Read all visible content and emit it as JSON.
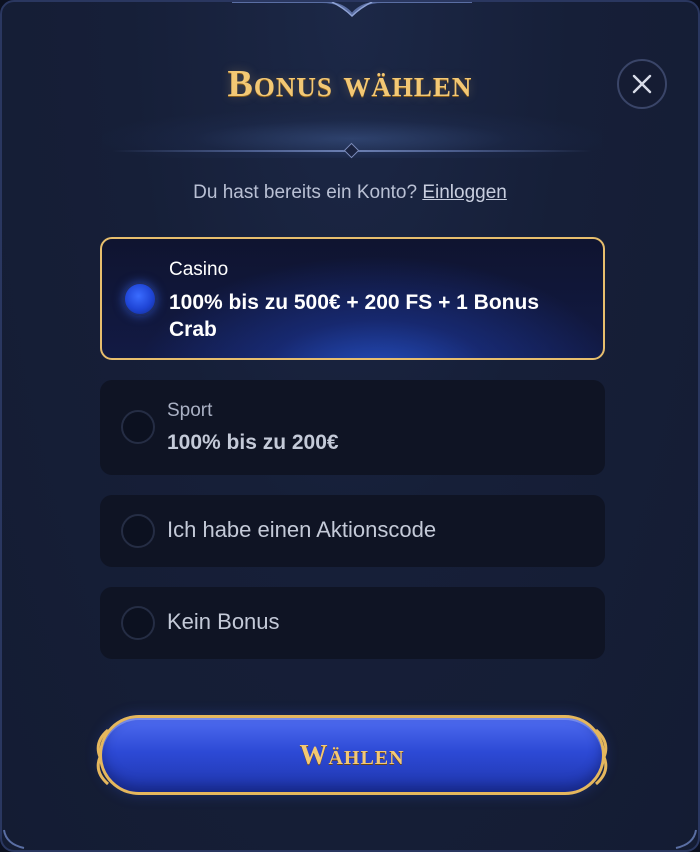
{
  "modal": {
    "title": "Bonus wählen",
    "close_icon": "close-icon",
    "login_prompt": "Du hast bereits ein Konto?",
    "login_link": "Einloggen"
  },
  "options": [
    {
      "category": "Casino",
      "description": "100% bis zu 500€ + 200 FS + 1 Bonus Crab",
      "selected": true
    },
    {
      "category": "Sport",
      "description": "100% bis zu 200€",
      "selected": false
    },
    {
      "label": "Ich habe einen Aktionscode",
      "selected": false
    },
    {
      "label": "Kein Bonus",
      "selected": false
    }
  ],
  "submit": {
    "label": "Wählen"
  },
  "colors": {
    "accent_gold": "#f3c874",
    "selected_border": "#e7be6d",
    "primary_blue": "#2d4ad6",
    "background": "#161f38"
  }
}
